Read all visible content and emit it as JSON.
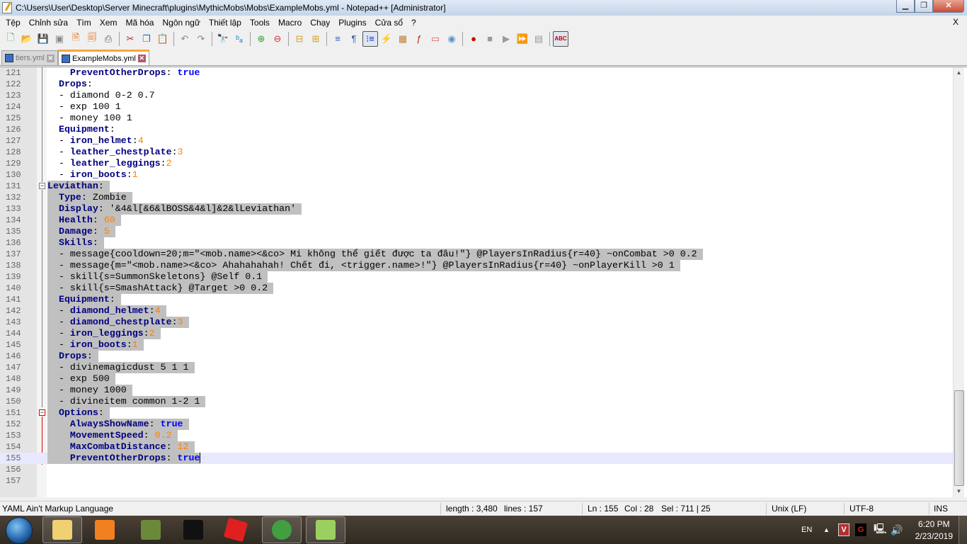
{
  "window": {
    "title": "C:\\Users\\User\\Desktop\\Server Minecraft\\plugins\\MythicMobs\\Mobs\\ExampleMobs.yml - Notepad++ [Administrator]",
    "minimize": "▁",
    "maximize": "❐",
    "close": "✕"
  },
  "menu": [
    "Tệp",
    "Chỉnh sửa",
    "Tìm",
    "Xem",
    "Mã hóa",
    "Ngôn ngữ",
    "Thiết lập",
    "Tools",
    "Macro",
    "Chạy",
    "Plugins",
    "Cửa sổ",
    "?"
  ],
  "menu_close": "X",
  "toolbar": [
    {
      "name": "new-file-icon",
      "glyph": "🗋",
      "color": "#3a9a3a"
    },
    {
      "name": "open-file-icon",
      "glyph": "📂",
      "color": "#d8a020"
    },
    {
      "name": "save-icon",
      "glyph": "💾",
      "color": "#888"
    },
    {
      "name": "save-all-icon",
      "glyph": "▣",
      "color": "#888"
    },
    {
      "name": "close-file-icon",
      "glyph": "🗎",
      "color": "#e06010"
    },
    {
      "name": "close-all-icon",
      "glyph": "🗐",
      "color": "#e06010"
    },
    {
      "name": "print-icon",
      "glyph": "⎙",
      "color": "#555"
    },
    {
      "sep": true
    },
    {
      "name": "cut-icon",
      "glyph": "✂",
      "color": "#c02020"
    },
    {
      "name": "copy-icon",
      "glyph": "❐",
      "color": "#3060c0"
    },
    {
      "name": "paste-icon",
      "glyph": "📋",
      "color": "#888"
    },
    {
      "sep": true
    },
    {
      "name": "undo-icon",
      "glyph": "↶",
      "color": "#888"
    },
    {
      "name": "redo-icon",
      "glyph": "↷",
      "color": "#888"
    },
    {
      "sep": true
    },
    {
      "name": "find-icon",
      "glyph": "🔭",
      "color": "#333"
    },
    {
      "name": "replace-icon",
      "glyph": "ᵇₐ",
      "color": "#2080c0"
    },
    {
      "sep": true
    },
    {
      "name": "zoom-in-icon",
      "glyph": "⊕",
      "color": "#30a030"
    },
    {
      "name": "zoom-out-icon",
      "glyph": "⊖",
      "color": "#d03030"
    },
    {
      "sep": true
    },
    {
      "name": "sync-vertical-icon",
      "glyph": "⊟",
      "color": "#d8a020"
    },
    {
      "name": "sync-horizontal-icon",
      "glyph": "⊞",
      "color": "#d8a020"
    },
    {
      "sep": true
    },
    {
      "name": "word-wrap-icon",
      "glyph": "≡",
      "color": "#3060c0"
    },
    {
      "name": "show-all-characters-icon",
      "glyph": "¶",
      "color": "#3060c0"
    },
    {
      "name": "indent-guide-icon",
      "glyph": "⁝≡",
      "color": "#1030c0",
      "active": true
    },
    {
      "name": "user-defined-language-icon",
      "glyph": "⚡",
      "color": "#e0a000"
    },
    {
      "name": "document-map-icon",
      "glyph": "▦",
      "color": "#c08030"
    },
    {
      "name": "function-list-icon",
      "glyph": "ƒ",
      "color": "#c02020"
    },
    {
      "name": "folder-workspace-icon",
      "glyph": "▭",
      "color": "#d06060"
    },
    {
      "name": "monitoring-eye-icon",
      "glyph": "◉",
      "color": "#6090c0"
    },
    {
      "sep": true
    },
    {
      "name": "record-macro-icon",
      "glyph": "●",
      "color": "#d00000"
    },
    {
      "name": "stop-recording-icon",
      "glyph": "■",
      "color": "#999"
    },
    {
      "name": "playback-macro-icon",
      "glyph": "▶",
      "color": "#999"
    },
    {
      "name": "run-macro-multiple-icon",
      "glyph": "⏩",
      "color": "#3060d0"
    },
    {
      "name": "save-macro-icon",
      "glyph": "▤",
      "color": "#999"
    },
    {
      "sep": true
    },
    {
      "name": "spell-check-icon",
      "glyph": "ABC",
      "color": "#c00000",
      "active": true
    }
  ],
  "tabs": [
    {
      "label": "tiers.yml",
      "active": false
    },
    {
      "label": "ExampleMobs.yml",
      "active": true
    }
  ],
  "editor": {
    "lines": [
      {
        "n": "121",
        "sel": false,
        "segs": [
          [
            "p",
            "    "
          ],
          [
            "k",
            "PreventOtherDrops"
          ],
          [
            "p",
            ": "
          ],
          [
            "b",
            "true"
          ]
        ]
      },
      {
        "n": "122",
        "sel": false,
        "segs": [
          [
            "p",
            "  "
          ],
          [
            "k",
            "Drops"
          ],
          [
            "p",
            ":"
          ]
        ]
      },
      {
        "n": "123",
        "sel": false,
        "segs": [
          [
            "p",
            "  - diamond 0-2 0.7"
          ]
        ]
      },
      {
        "n": "124",
        "sel": false,
        "segs": [
          [
            "p",
            "  - exp 100 1"
          ]
        ]
      },
      {
        "n": "125",
        "sel": false,
        "segs": [
          [
            "p",
            "  - money 100 1"
          ]
        ]
      },
      {
        "n": "126",
        "sel": false,
        "segs": [
          [
            "p",
            "  "
          ],
          [
            "k",
            "Equipment"
          ],
          [
            "p",
            ":"
          ]
        ]
      },
      {
        "n": "127",
        "sel": false,
        "segs": [
          [
            "p",
            "  - "
          ],
          [
            "k",
            "iron_helmet"
          ],
          [
            "p",
            ":"
          ],
          [
            "n",
            "4"
          ]
        ]
      },
      {
        "n": "128",
        "sel": false,
        "segs": [
          [
            "p",
            "  - "
          ],
          [
            "k",
            "leather_chestplate"
          ],
          [
            "p",
            ":"
          ],
          [
            "n",
            "3"
          ]
        ]
      },
      {
        "n": "129",
        "sel": false,
        "segs": [
          [
            "p",
            "  - "
          ],
          [
            "k",
            "leather_leggings"
          ],
          [
            "p",
            ":"
          ],
          [
            "n",
            "2"
          ]
        ]
      },
      {
        "n": "130",
        "sel": false,
        "segs": [
          [
            "p",
            "  - "
          ],
          [
            "k",
            "iron_boots"
          ],
          [
            "p",
            ":"
          ],
          [
            "n",
            "1"
          ]
        ]
      },
      {
        "n": "131",
        "sel": true,
        "segs": [
          [
            "k",
            "Leviathan"
          ],
          [
            "p",
            ":"
          ]
        ]
      },
      {
        "n": "132",
        "sel": true,
        "segs": [
          [
            "p",
            "  "
          ],
          [
            "k",
            "Type"
          ],
          [
            "p",
            ": Zombie"
          ]
        ]
      },
      {
        "n": "133",
        "sel": true,
        "segs": [
          [
            "p",
            "  "
          ],
          [
            "k",
            "Display"
          ],
          [
            "p",
            ": '&4&l[&6&lBOSS&4&l]&2&lLeviathan'"
          ]
        ]
      },
      {
        "n": "134",
        "sel": true,
        "segs": [
          [
            "p",
            "  "
          ],
          [
            "k",
            "Health"
          ],
          [
            "p",
            ": "
          ],
          [
            "n",
            "60"
          ]
        ]
      },
      {
        "n": "135",
        "sel": true,
        "segs": [
          [
            "p",
            "  "
          ],
          [
            "k",
            "Damage"
          ],
          [
            "p",
            ": "
          ],
          [
            "n",
            "5"
          ]
        ]
      },
      {
        "n": "136",
        "sel": true,
        "segs": [
          [
            "p",
            "  "
          ],
          [
            "k",
            "Skills"
          ],
          [
            "p",
            ":"
          ]
        ]
      },
      {
        "n": "137",
        "sel": true,
        "segs": [
          [
            "p",
            "  - message{cooldown=20;m=\"<mob.name><&co> Mi không thể giết được ta đâu!\"} @PlayersInRadius{r=40} ~onCombat >0 0.2"
          ]
        ]
      },
      {
        "n": "138",
        "sel": true,
        "segs": [
          [
            "p",
            "  - message{m=\"<mob.name><&co> Ahahahahah! Chết đi, <trigger.name>!\"} @PlayersInRadius{r=40} ~onPlayerKill >0 1"
          ]
        ]
      },
      {
        "n": "139",
        "sel": true,
        "segs": [
          [
            "p",
            "  - skill{s=SummonSkeletons} @Self 0.1"
          ]
        ]
      },
      {
        "n": "140",
        "sel": true,
        "segs": [
          [
            "p",
            "  - skill{s=SmashAttack} @Target >0 0.2"
          ]
        ]
      },
      {
        "n": "141",
        "sel": true,
        "segs": [
          [
            "p",
            "  "
          ],
          [
            "k",
            "Equipment"
          ],
          [
            "p",
            ":"
          ]
        ]
      },
      {
        "n": "142",
        "sel": true,
        "segs": [
          [
            "p",
            "  - "
          ],
          [
            "k",
            "diamond_helmet"
          ],
          [
            "p",
            ":"
          ],
          [
            "n",
            "4"
          ]
        ]
      },
      {
        "n": "143",
        "sel": true,
        "segs": [
          [
            "p",
            "  - "
          ],
          [
            "k",
            "diamond_chestplate"
          ],
          [
            "p",
            ":"
          ],
          [
            "n",
            "3"
          ]
        ]
      },
      {
        "n": "144",
        "sel": true,
        "segs": [
          [
            "p",
            "  - "
          ],
          [
            "k",
            "iron_leggings"
          ],
          [
            "p",
            ":"
          ],
          [
            "n",
            "2"
          ]
        ]
      },
      {
        "n": "145",
        "sel": true,
        "segs": [
          [
            "p",
            "  - "
          ],
          [
            "k",
            "iron_boots"
          ],
          [
            "p",
            ":"
          ],
          [
            "n",
            "1"
          ]
        ]
      },
      {
        "n": "146",
        "sel": true,
        "segs": [
          [
            "p",
            "  "
          ],
          [
            "k",
            "Drops"
          ],
          [
            "p",
            ":"
          ]
        ]
      },
      {
        "n": "147",
        "sel": true,
        "segs": [
          [
            "p",
            "  - divinemagicdust 5 1 1"
          ]
        ]
      },
      {
        "n": "148",
        "sel": true,
        "segs": [
          [
            "p",
            "  - exp 500"
          ]
        ]
      },
      {
        "n": "149",
        "sel": true,
        "segs": [
          [
            "p",
            "  - money 1000"
          ]
        ]
      },
      {
        "n": "150",
        "sel": true,
        "segs": [
          [
            "p",
            "  - divineitem common 1-2 1"
          ]
        ]
      },
      {
        "n": "151",
        "sel": true,
        "segs": [
          [
            "p",
            "  "
          ],
          [
            "k",
            "Options"
          ],
          [
            "p",
            ":"
          ]
        ]
      },
      {
        "n": "152",
        "sel": true,
        "segs": [
          [
            "p",
            "    "
          ],
          [
            "k",
            "AlwaysShowName"
          ],
          [
            "p",
            ": "
          ],
          [
            "b",
            "true"
          ]
        ]
      },
      {
        "n": "153",
        "sel": true,
        "segs": [
          [
            "p",
            "    "
          ],
          [
            "k",
            "MovementSpeed"
          ],
          [
            "p",
            ": "
          ],
          [
            "n",
            "0.2"
          ]
        ]
      },
      {
        "n": "154",
        "sel": true,
        "segs": [
          [
            "p",
            "    "
          ],
          [
            "k",
            "MaxCombatDistance"
          ],
          [
            "p",
            ": "
          ],
          [
            "n",
            "12"
          ]
        ]
      },
      {
        "n": "155",
        "sel": true,
        "current": true,
        "last": true,
        "segs": [
          [
            "p",
            "    "
          ],
          [
            "k",
            "PreventOtherDrops"
          ],
          [
            "p",
            ": "
          ],
          [
            "b",
            "true"
          ]
        ]
      },
      {
        "n": "156",
        "sel": false,
        "segs": []
      },
      {
        "n": "157",
        "sel": false,
        "segs": []
      }
    ]
  },
  "status": {
    "language": "YAML Ain't Markup Language",
    "length": "length : 3,480",
    "lines": "lines : 157",
    "ln": "Ln : 155",
    "col": "Col : 28",
    "sel": "Sel : 711 | 25",
    "eol": "Unix (LF)",
    "encoding": "UTF-8",
    "mode": "INS"
  },
  "taskbar": {
    "lang": "EN",
    "time": "6:20 PM",
    "date": "2/23/2019",
    "apps": [
      {
        "name": "file-explorer-icon",
        "color": "#f0d070",
        "pinned": true
      },
      {
        "name": "media-player-icon",
        "color": "#f08020"
      },
      {
        "name": "minecraft-icon",
        "color": "#6a8a3a"
      },
      {
        "name": "garena-icon",
        "color": "#111"
      },
      {
        "name": "roblox-icon",
        "color": "#e02020"
      },
      {
        "name": "coc-coc-browser-icon",
        "color": "#40a040",
        "pinned": true
      },
      {
        "name": "notepad-plus-plus-icon",
        "color": "#9ad060",
        "pinned": true
      }
    ]
  }
}
